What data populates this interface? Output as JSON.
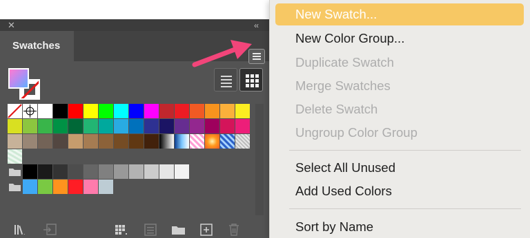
{
  "panel": {
    "close_glyph": "✕",
    "collapse_glyph": "‹‹",
    "tab_label": "Swatches",
    "icons": {
      "menu": "hamburger-menu-icon",
      "list_view": "list-view-icon",
      "grid_view": "grid-view-icon",
      "library": "libraries-icon",
      "place": "place-swatches-icon",
      "kind": "show-swatch-kinds-icon",
      "options": "swatch-options-icon",
      "group": "new-color-group-icon",
      "new": "new-swatch-icon",
      "delete": "delete-swatch-icon"
    },
    "swatch_rows": [
      [
        "none",
        "registration",
        "#ffffff",
        "#000000",
        "#ff0000",
        "#ffff00",
        "#00ff00",
        "#00ffff",
        "#0000ff",
        "#ff00ff",
        "#c1272d",
        "#ed1c24",
        "#f15a24",
        "#f7931e",
        "#fbb03b",
        "#fcee21"
      ],
      [
        "#d9e021",
        "#8cc63f",
        "#39b54a",
        "#009245",
        "#006837",
        "#22b573",
        "#00a99d",
        "#29abe2",
        "#0071bc",
        "#2e3192",
        "#1b1464",
        "#662d91",
        "#93278f",
        "#9e005d",
        "#d4145a",
        "#ed1e79"
      ],
      [
        "#c7b299",
        "#998675",
        "#736357",
        "#534741",
        "#c69c6d",
        "#a67c52",
        "#8c6239",
        "#754c24",
        "#603813",
        "#42210b",
        "grad-bw",
        "grad-blue",
        "pattern-pink",
        "grad-orange",
        "pattern-blue",
        "pattern-check"
      ],
      [
        "pattern-leaves"
      ],
      [
        "folder",
        "#000000",
        "#1a1a1a",
        "#333333",
        "#4d4d4d",
        "#666666",
        "#808080",
        "#999999",
        "#b3b3b3",
        "#cccccc",
        "#e6e6e6",
        "#f2f2f2"
      ],
      [
        "folder",
        "#3fa9f5",
        "#7ac943",
        "#ff931e",
        "#ff1d25",
        "#ff7bac",
        "#bdccd4"
      ]
    ]
  },
  "arrow_color": "#f2457a",
  "menu": {
    "highlight_color": "#f7c864",
    "items": [
      {
        "label": "New Swatch...",
        "state": "highlighted"
      },
      {
        "label": "New Color Group...",
        "state": "enabled"
      },
      {
        "label": "Duplicate Swatch",
        "state": "disabled"
      },
      {
        "label": "Merge Swatches",
        "state": "disabled"
      },
      {
        "label": "Delete Swatch",
        "state": "disabled"
      },
      {
        "label": "Ungroup Color Group",
        "state": "disabled"
      },
      {
        "label": "Select All Unused",
        "state": "enabled"
      },
      {
        "label": "Add Used Colors",
        "state": "enabled"
      },
      {
        "label": "Sort by Name",
        "state": "enabled"
      }
    ]
  }
}
